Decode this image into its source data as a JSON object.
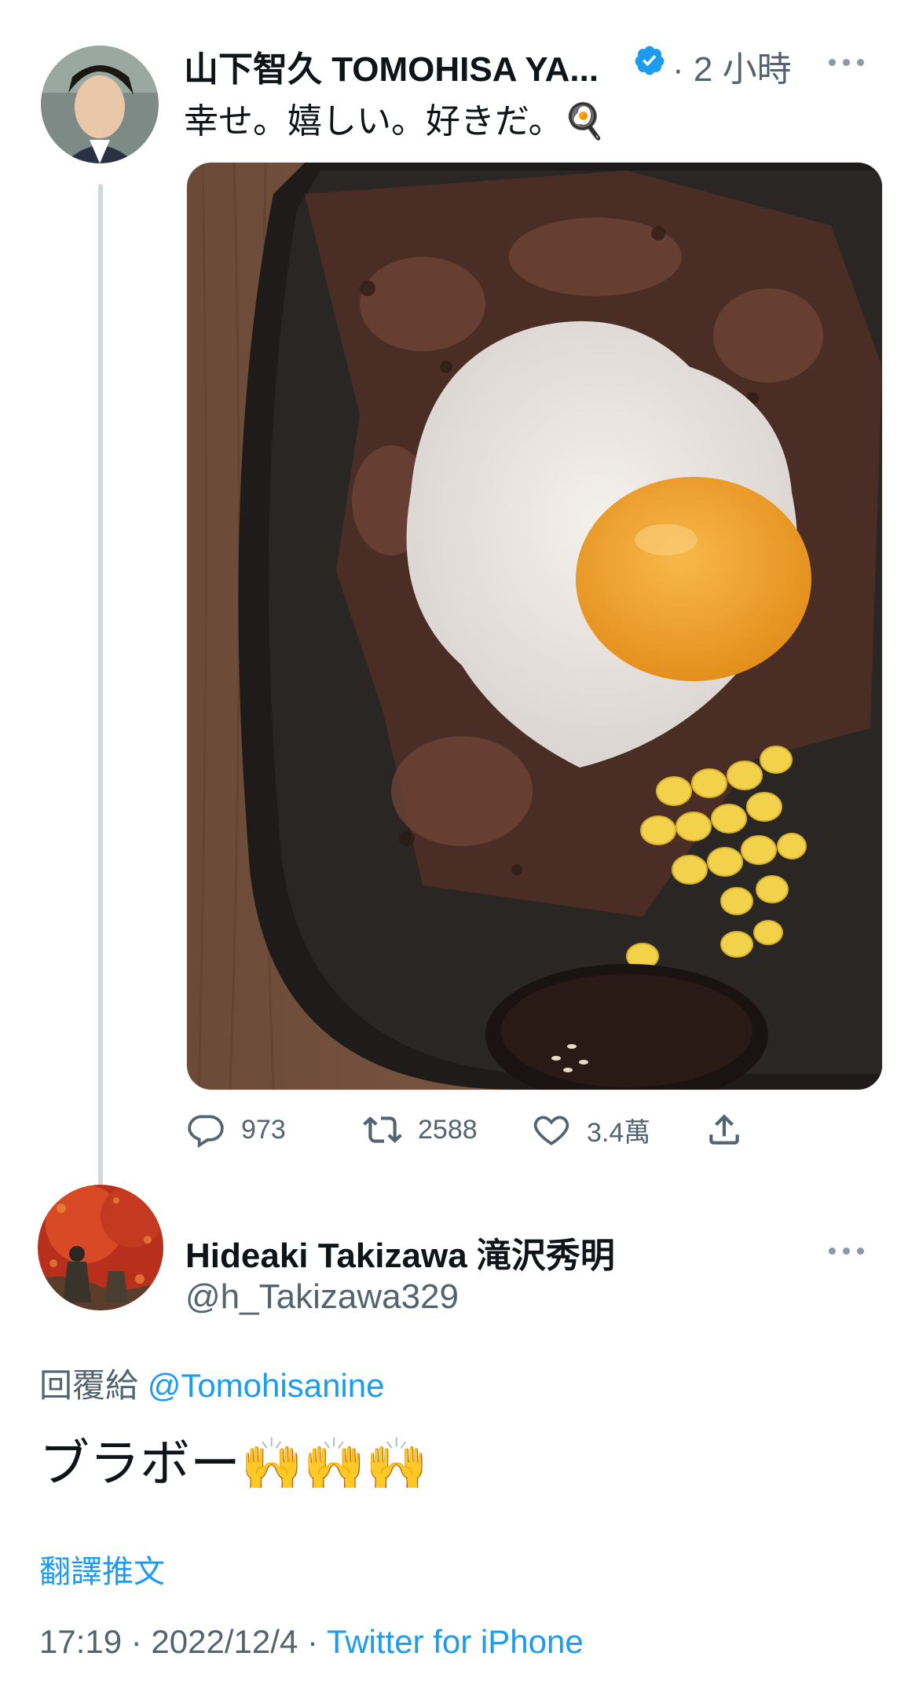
{
  "tweet": {
    "display_name": "山下智久 TOMOHISA YA...",
    "verified": true,
    "time_ago": "· 2 小時",
    "text": "幸せ。嬉しい。好きだ。",
    "emoji": "🍳",
    "stats": {
      "replies": "973",
      "retweets": "2588",
      "likes": "3.4萬"
    }
  },
  "reply": {
    "display_name": "Hideaki Takizawa 滝沢秀明",
    "handle": "@h_Takizawa329",
    "reply_to_label": "回覆給",
    "reply_to_handle": "@Tomohisanine",
    "text": "ブラボー🙌🙌🙌",
    "translate_label": "翻譯推文",
    "timestamp": "17:19 · 2022/12/4 ·",
    "source": "Twitter for iPhone"
  },
  "colors": {
    "accent": "#1d9bf0",
    "muted": "#536471",
    "thread_line": "#cfd9de"
  },
  "icons": [
    "verified-badge-icon",
    "more-icon",
    "reply-icon",
    "retweet-icon",
    "like-icon",
    "share-icon"
  ]
}
